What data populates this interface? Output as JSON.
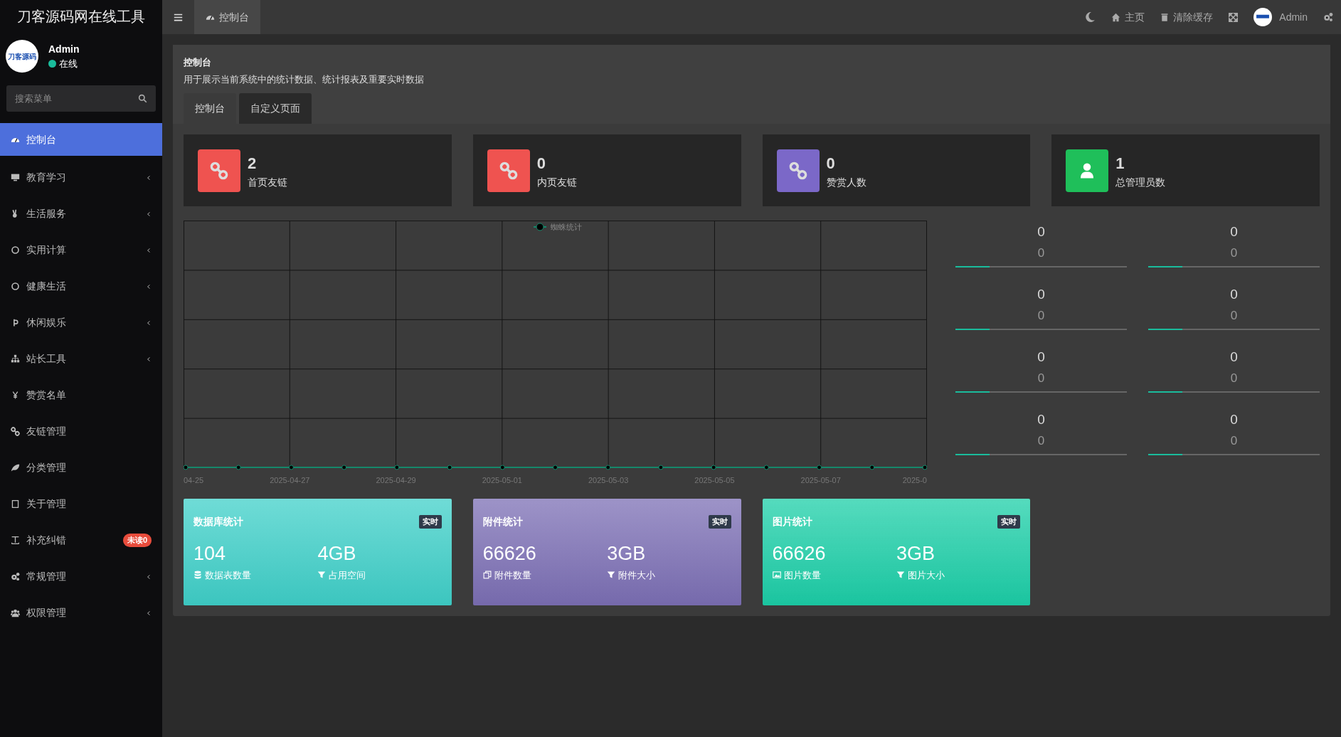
{
  "brand": "刀客源码网在线工具",
  "user": {
    "avatar_text": "刀客源码",
    "name": "Admin",
    "status": "在线",
    "online": true
  },
  "search": {
    "placeholder": "搜索菜单"
  },
  "sidebar": {
    "items": [
      {
        "label": "控制台",
        "selected": true,
        "has_children": false
      },
      {
        "label": "教育学习",
        "selected": false,
        "has_children": true
      },
      {
        "label": "生活服务",
        "selected": false,
        "has_children": true
      },
      {
        "label": "实用计算",
        "selected": false,
        "has_children": true
      },
      {
        "label": "健康生活",
        "selected": false,
        "has_children": true
      },
      {
        "label": "休闲娱乐",
        "selected": false,
        "has_children": true
      },
      {
        "label": "站长工具",
        "selected": false,
        "has_children": true
      },
      {
        "label": "赞赏名单",
        "selected": false,
        "has_children": false
      },
      {
        "label": "友链管理",
        "selected": false,
        "has_children": false
      },
      {
        "label": "分类管理",
        "selected": false,
        "has_children": false
      },
      {
        "label": "关于管理",
        "selected": false,
        "has_children": false
      },
      {
        "label": "补充纠错",
        "selected": false,
        "has_children": false,
        "badge": "未读0"
      },
      {
        "label": "常规管理",
        "selected": false,
        "has_children": true
      },
      {
        "label": "权限管理",
        "selected": false,
        "has_children": true
      }
    ]
  },
  "top_tabs": [
    {
      "label": "控制台",
      "selected": true
    }
  ],
  "top_actions": [
    {
      "kind": "theme"
    },
    {
      "kind": "link",
      "label": "主页"
    },
    {
      "kind": "clear",
      "label": "清除缓存"
    },
    {
      "kind": "fullscreen"
    },
    {
      "kind": "user",
      "label": "Admin"
    },
    {
      "kind": "settings"
    }
  ],
  "page": {
    "title": "控制台",
    "description": "用于展示当前系统中的统计数据、统计报表及重要实时数据"
  },
  "page_tabs": [
    {
      "label": "控制台",
      "selected": true
    },
    {
      "label": "自定义页面",
      "selected": false
    }
  ],
  "stat_cards": [
    {
      "value": "2",
      "label": "首页友链",
      "color": "#ef5350",
      "kind": "link"
    },
    {
      "value": "0",
      "label": "内页友链",
      "color": "#ef5350",
      "kind": "link"
    },
    {
      "value": "0",
      "label": "赞赏人数",
      "color": "#7b68c8",
      "kind": "link"
    },
    {
      "value": "1",
      "label": "总管理员数",
      "color": "#1fbf5a",
      "kind": "user"
    }
  ],
  "chart": {
    "legend": "蜘蛛统计",
    "x_labels": [
      "04-25",
      "2025-04-27",
      "2025-04-29",
      "2025-05-01",
      "2025-05-03",
      "2025-05-05",
      "2025-05-07",
      "2025-0"
    ]
  },
  "mini_stats": [
    {
      "value": "0",
      "sub": "0",
      "level": 0.2
    },
    {
      "value": "0",
      "sub": "0",
      "level": 0.2
    },
    {
      "value": "0",
      "sub": "0",
      "level": 0.2
    },
    {
      "value": "0",
      "sub": "0",
      "level": 0.2
    },
    {
      "value": "0",
      "sub": "0",
      "level": 0.2
    },
    {
      "value": "0",
      "sub": "0",
      "level": 0.2
    },
    {
      "value": "0",
      "sub": "0",
      "level": 0.2
    },
    {
      "value": "0",
      "sub": "0",
      "level": 0.2
    }
  ],
  "summary_cards": [
    {
      "title": "数据库统计",
      "badge": "实时",
      "color": "#3fd0c9",
      "items": [
        {
          "value": "104",
          "label": "数据表数量",
          "kind": "database"
        },
        {
          "value": "4GB",
          "label": "占用空间",
          "kind": "filter"
        }
      ]
    },
    {
      "title": "附件统计",
      "badge": "实时",
      "color": "#7c6fb5",
      "items": [
        {
          "value": "66626",
          "label": "附件数量",
          "kind": "files"
        },
        {
          "value": "3GB",
          "label": "附件大小",
          "kind": "filter"
        }
      ]
    },
    {
      "title": "图片统计",
      "badge": "实时",
      "color": "#1ccfa8",
      "items": [
        {
          "value": "66626",
          "label": "图片数量",
          "kind": "image"
        },
        {
          "value": "3GB",
          "label": "图片大小",
          "kind": "filter"
        }
      ]
    }
  ]
}
